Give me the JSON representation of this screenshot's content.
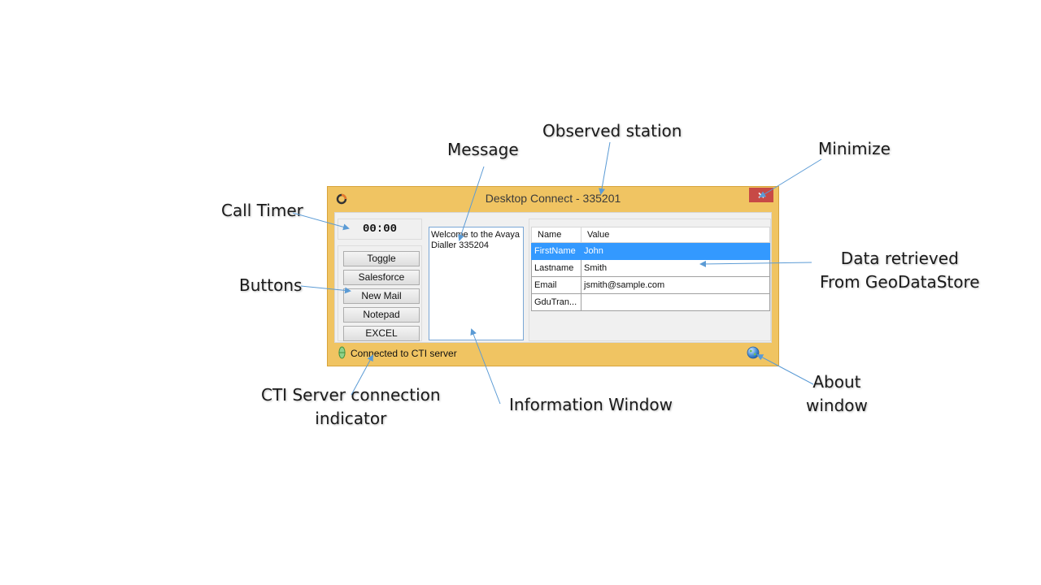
{
  "callouts": {
    "observed_station": "Observed station",
    "message": "Message",
    "minimize": "Minimize",
    "call_timer": "Call Timer",
    "buttons": "Buttons",
    "data_retrieved_1": "Data retrieved",
    "data_retrieved_2": "From GeoDataStore",
    "cti_1": "CTI Server connection",
    "cti_2": "indicator",
    "info_window": "Information Window",
    "about_1": "About",
    "about_2": "window"
  },
  "window": {
    "title": "Desktop Connect - 335201",
    "close_label": "×",
    "icons": {
      "app": "app-ring-icon",
      "close": "close-icon",
      "connection": "connection-indicator-icon",
      "about": "globe-icon"
    },
    "colors": {
      "frame": "#f0c462",
      "close": "#c74a46",
      "selected_row": "#3399ff",
      "accent_line": "#5b9bd5"
    }
  },
  "timer": {
    "value": "00:00"
  },
  "buttons": [
    {
      "label": "Toggle"
    },
    {
      "label": "Salesforce"
    },
    {
      "label": "New Mail"
    },
    {
      "label": "Notepad"
    },
    {
      "label": "EXCEL"
    }
  ],
  "message": {
    "text": "Welcome to the Avaya Dialler 335204"
  },
  "grid": {
    "columns": [
      "Name",
      "Value"
    ],
    "rows": [
      {
        "name": "FirstName",
        "value": "John",
        "selected": true
      },
      {
        "name": "Lastname",
        "value": "Smith"
      },
      {
        "name": "Email",
        "value": "jsmith@sample.com"
      },
      {
        "name": "GduTran...",
        "value": ""
      }
    ]
  },
  "status": {
    "text": "Connected to CTI server"
  }
}
